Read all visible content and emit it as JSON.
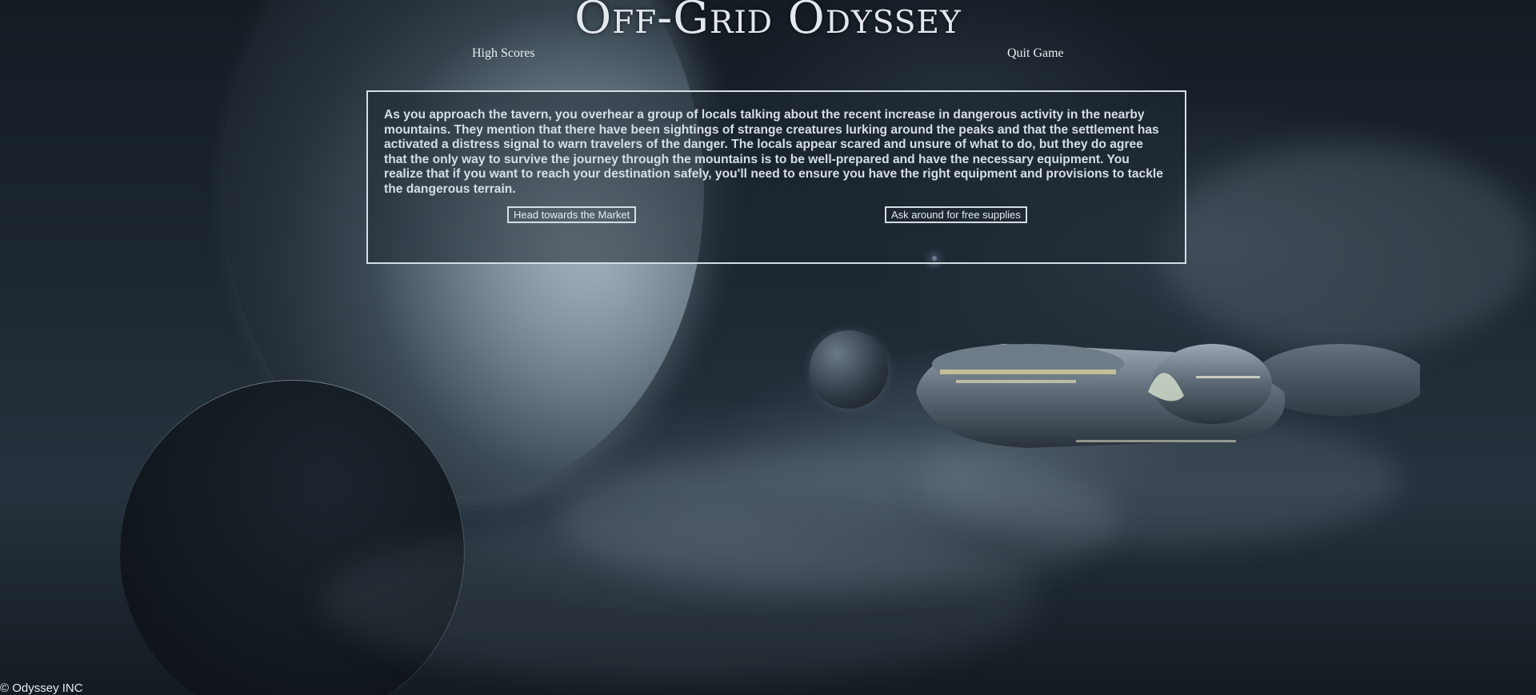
{
  "header": {
    "title": "Off-Grid Odyssey",
    "nav": {
      "high_scores": "High Scores",
      "quit_game": "Quit Game"
    }
  },
  "story": {
    "text": "As you approach the tavern, you overhear a group of locals talking about the recent increase in dangerous activity in the nearby mountains. They mention that there have been sightings of strange creatures lurking around the peaks and that the settlement has activated a distress signal to warn travelers of the danger. The locals appear scared and unsure of what to do, but they do agree that the only way to survive the journey through the mountains is to be well-prepared and have the necessary equipment. You realize that if you want to reach your destination safely, you'll need to ensure you have the right equipment and provisions to tackle the dangerous terrain.",
    "choices": [
      {
        "label": "Head towards the Market"
      },
      {
        "label": "Ask around for free supplies"
      }
    ]
  },
  "footer": {
    "copyright": "© Odyssey INC"
  },
  "colors": {
    "text": "#dfe6ec",
    "border": "#d5dde4",
    "background": "#1d2731"
  }
}
